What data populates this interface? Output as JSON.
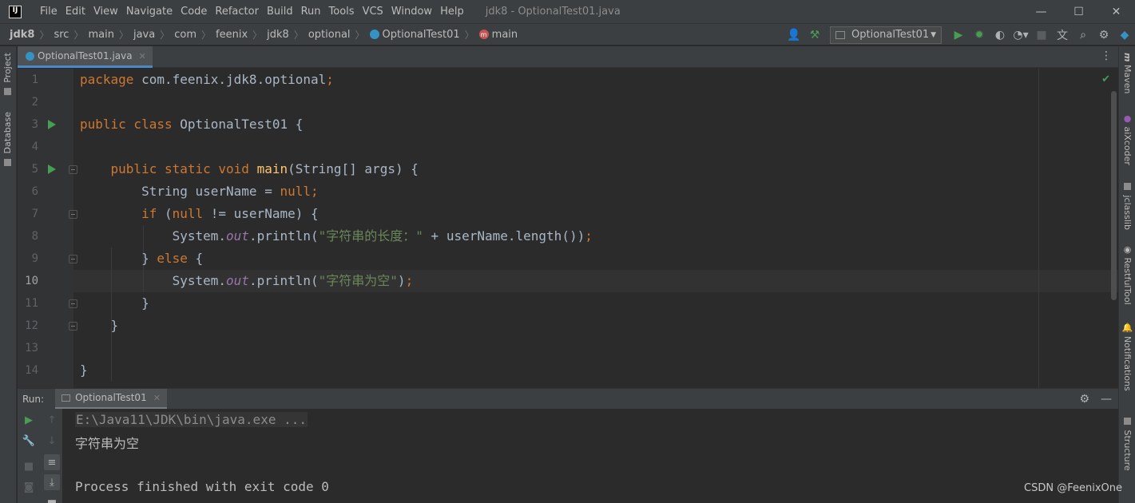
{
  "window": {
    "title": "jdk8 - OptionalTest01.java",
    "menu": [
      "File",
      "Edit",
      "View",
      "Navigate",
      "Code",
      "Refactor",
      "Build",
      "Run",
      "Tools",
      "VCS",
      "Window",
      "Help"
    ],
    "controls": {
      "minimize": "—",
      "maximize": "☐",
      "close": "✕"
    }
  },
  "breadcrumbs": [
    "jdk8",
    "src",
    "main",
    "java",
    "com",
    "feenix",
    "jdk8",
    "optional",
    "OptionalTest01",
    "main"
  ],
  "toolbar": {
    "run_config": "OptionalTest01",
    "icons": [
      "user-icon",
      "build-hammer-icon",
      "run-icon",
      "debug-icon",
      "coverage-icon",
      "profile-icon",
      "stop-icon",
      "translate-icon",
      "search-icon",
      "settings-icon",
      "ide-logo-icon"
    ]
  },
  "left_tools": [
    "Project",
    "Database"
  ],
  "right_tools": [
    "Maven",
    "aiXcoder",
    "jclasslib",
    "RestfulTool",
    "Notifications",
    "Structure"
  ],
  "editor": {
    "tab_label": "OptionalTest01.java",
    "current_line": 10,
    "line_numbers": [
      "1",
      "2",
      "3",
      "4",
      "5",
      "6",
      "7",
      "8",
      "9",
      "10",
      "11",
      "12",
      "13",
      "14"
    ],
    "lines": [
      [
        {
          "t": "package",
          "c": "kw"
        },
        {
          "t": " com.feenix.jdk8.optional",
          "c": ""
        },
        {
          "t": ";",
          "c": "kw"
        }
      ],
      [],
      [
        {
          "t": "public class",
          "c": "kw"
        },
        {
          "t": " OptionalTest01 {",
          "c": ""
        }
      ],
      [],
      [
        {
          "t": "    ",
          "c": ""
        },
        {
          "t": "public static void",
          "c": "kw"
        },
        {
          "t": " ",
          "c": ""
        },
        {
          "t": "main",
          "c": "fn"
        },
        {
          "t": "(String[] args) {",
          "c": ""
        }
      ],
      [
        {
          "t": "        String userName = ",
          "c": ""
        },
        {
          "t": "null;",
          "c": "kw"
        }
      ],
      [
        {
          "t": "        ",
          "c": ""
        },
        {
          "t": "if",
          "c": "kw"
        },
        {
          "t": " (",
          "c": ""
        },
        {
          "t": "null",
          "c": "kw"
        },
        {
          "t": " != userName) {",
          "c": ""
        }
      ],
      [
        {
          "t": "            System.",
          "c": ""
        },
        {
          "t": "out",
          "c": "fld"
        },
        {
          "t": ".println(",
          "c": ""
        },
        {
          "t": "\"字符串的长度：\"",
          "c": "st"
        },
        {
          "t": " + userName.length())",
          "c": ""
        },
        {
          "t": ";",
          "c": "kw"
        }
      ],
      [
        {
          "t": "        } ",
          "c": ""
        },
        {
          "t": "else",
          "c": "kw"
        },
        {
          "t": " {",
          "c": ""
        }
      ],
      [
        {
          "t": "            System.",
          "c": ""
        },
        {
          "t": "out",
          "c": "fld"
        },
        {
          "t": ".println(",
          "c": ""
        },
        {
          "t": "\"字符串为空\"",
          "c": "st"
        },
        {
          "t": ")",
          "c": ""
        },
        {
          "t": ";",
          "c": "kw"
        }
      ],
      [
        {
          "t": "        }",
          "c": ""
        }
      ],
      [
        {
          "t": "    }",
          "c": ""
        }
      ],
      [],
      [
        {
          "t": "}",
          "c": ""
        }
      ]
    ]
  },
  "run_panel": {
    "label": "Run:",
    "tab_label": "OptionalTest01",
    "console": {
      "command": "E:\\Java11\\JDK\\bin\\java.exe ...",
      "output": "字符串为空",
      "exit": "Process finished with exit code 0"
    }
  },
  "watermark": "CSDN @FeenixOne"
}
